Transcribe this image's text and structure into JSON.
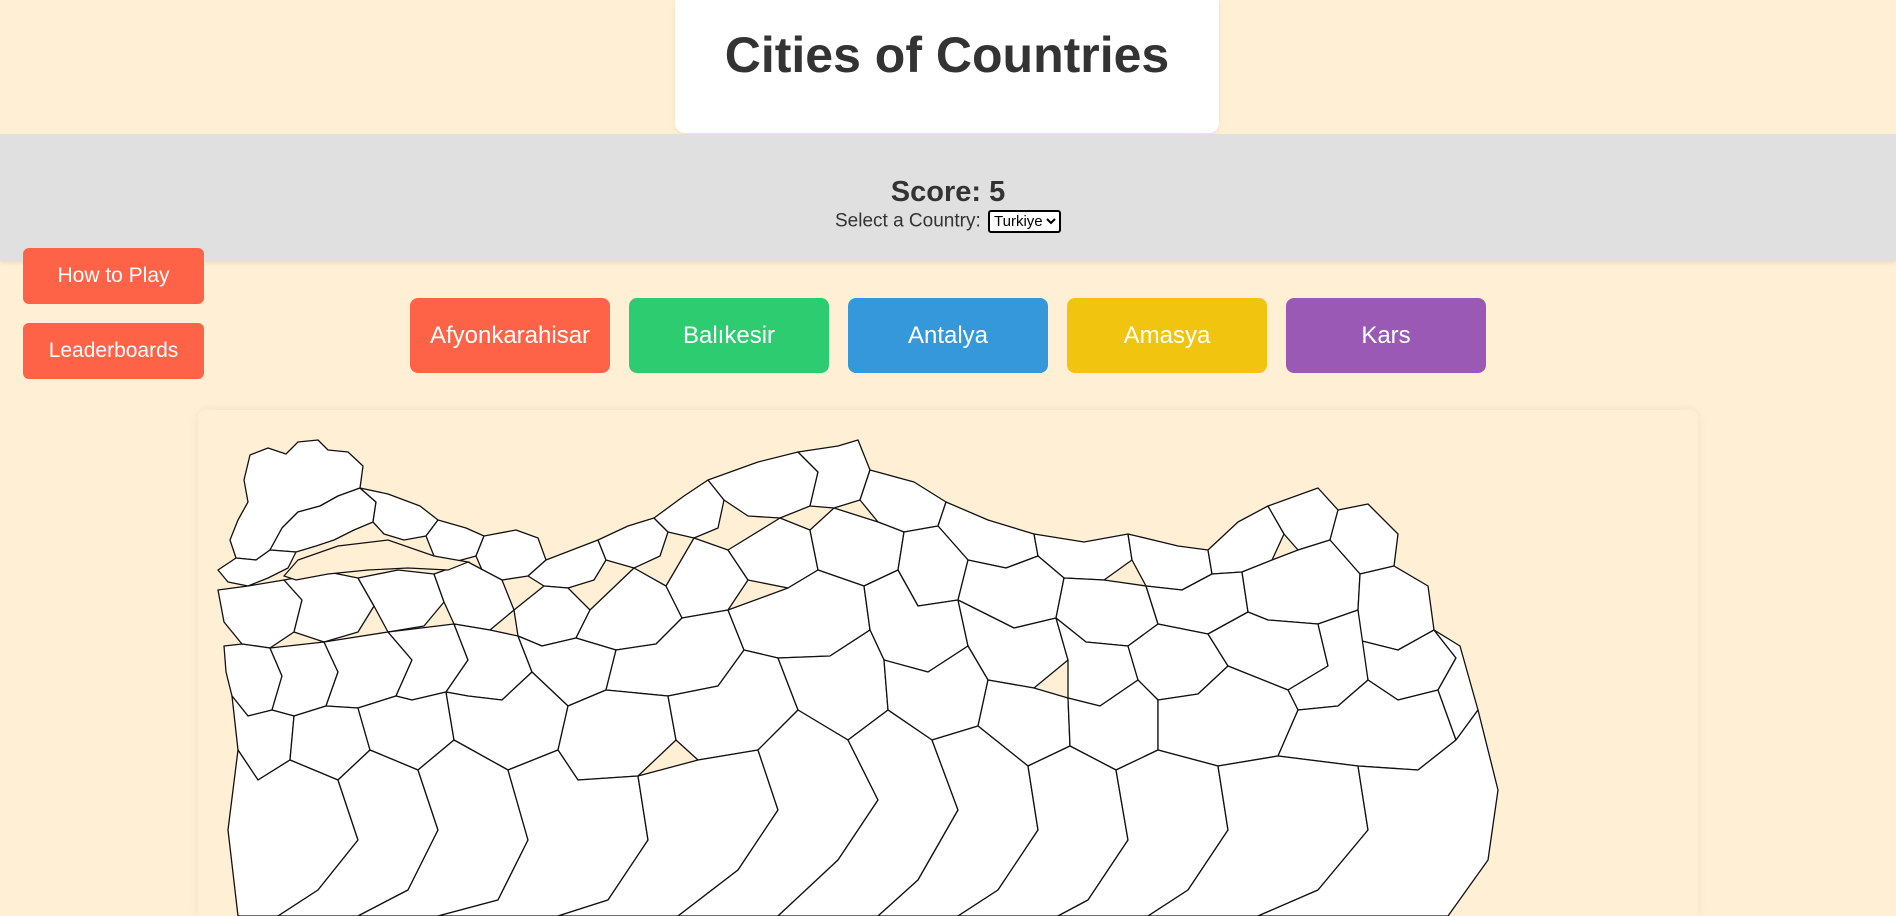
{
  "header": {
    "title": "Cities of Countries"
  },
  "scoreboard": {
    "score_label": "Score: 5",
    "select_label": "Select a Country:",
    "selected_country": "Turkiye"
  },
  "sidebar": {
    "how_to_play": "How to Play",
    "leaderboards": "Leaderboards"
  },
  "choices": [
    {
      "label": "Afyonkarahisar",
      "color": "#ff6347"
    },
    {
      "label": "Balıkesir",
      "color": "#2ecc71"
    },
    {
      "label": "Antalya",
      "color": "#3498db"
    },
    {
      "label": "Amasya",
      "color": "#f1c40f"
    },
    {
      "label": "Kars",
      "color": "#9b59b6"
    }
  ],
  "colors": {
    "background": "#ffefd5",
    "bar": "#e0e0e0",
    "accent": "#ff6347"
  },
  "map": {
    "country": "Turkiye"
  }
}
